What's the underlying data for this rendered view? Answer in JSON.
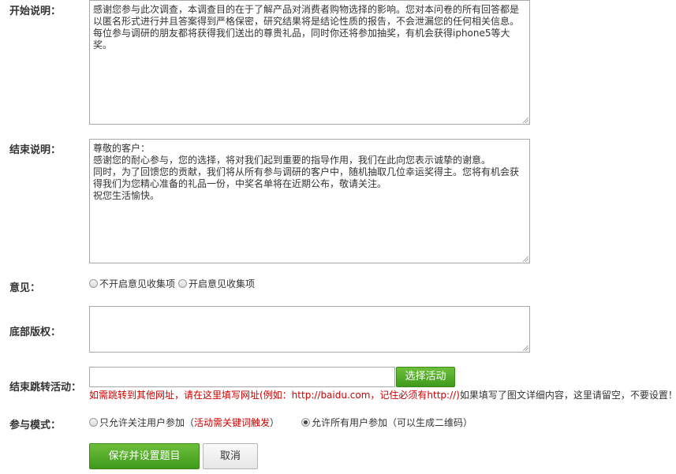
{
  "form": {
    "intro": {
      "label": "开始说明：",
      "text": "感谢您参与此次调查，本调查目的在于了解产品对消费者购物选择的影响。您对本问卷的所有回答都是以匿名形式进行并且答案得到严格保密，研究结果将是结论性质的报告，不会泄漏您的任何相关信息。每位参与调研的朋友都将获得我们送出的尊贵礼品，同时你还将参加抽奖，有机会获得iphone5等大奖。"
    },
    "ending": {
      "label": "结束说明：",
      "text": "尊敬的客户：\n感谢您的耐心参与，您的选择，将对我们起到重要的指导作用，我们在此向您表示诚挚的谢意。\n同时，为了回馈您的贡献，我们将从所有参与调研的客户中，随机抽取几位幸运奖得主。您将有机会获得我们为您精心准备的礼品一份，中奖名单将在近期公布，敬请关注。\n祝您生活愉快。"
    },
    "feedback": {
      "label": "意见：",
      "options": [
        "不开启意见收集项",
        "开启意见收集项"
      ]
    },
    "copyright": {
      "label": "底部版权：",
      "text": ""
    },
    "redirect": {
      "label": "结束跳转活动：",
      "value": "",
      "button": "选择活动",
      "hint_red": "如需跳转到其他网址，请在这里填写网址(例如：http://baidu.com，记住必须有http://)",
      "hint_normal": "如果填写了图文详细内容，这里请留空，不要设置！"
    },
    "mode": {
      "label": "参与模式：",
      "option1": "只允许关注用户参加（",
      "option1_red": "活动需关键词触发",
      "option1_end": "）",
      "option2": "允许所有用户参加（可以生成二维码）"
    },
    "actions": {
      "save": "保存并设置题目",
      "cancel": "取消"
    }
  }
}
